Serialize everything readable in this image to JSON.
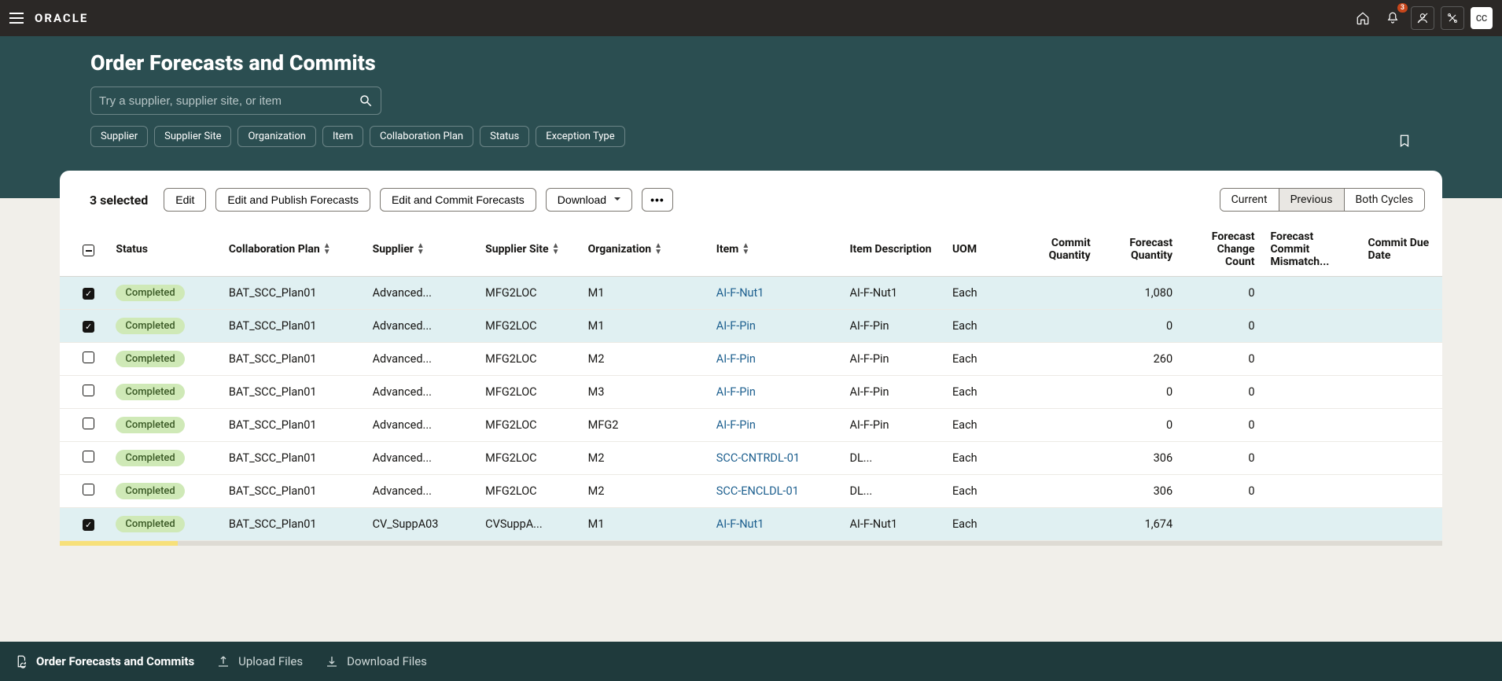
{
  "header": {
    "logo": "ORACLE",
    "notification_count": "3",
    "avatar": "CC"
  },
  "page": {
    "title": "Order Forecasts and Commits",
    "search_placeholder": "Try a supplier, supplier site, or item"
  },
  "filters": [
    "Supplier",
    "Supplier Site",
    "Organization",
    "Item",
    "Collaboration Plan",
    "Status",
    "Exception Type"
  ],
  "toolbar": {
    "selected": "3 selected",
    "edit": "Edit",
    "edit_publish": "Edit and Publish Forecasts",
    "edit_commit": "Edit and Commit Forecasts",
    "download": "Download",
    "seg": {
      "current": "Current",
      "previous": "Previous",
      "both": "Both Cycles"
    }
  },
  "columns": {
    "status": "Status",
    "plan": "Collaboration Plan",
    "supplier": "Supplier",
    "site": "Supplier Site",
    "org": "Organization",
    "item": "Item",
    "desc": "Item Description",
    "uom": "UOM",
    "cq": "Commit Quantity",
    "fq": "Forecast Quantity",
    "fcc": "Forecast Change Count",
    "fcm": "Forecast Commit Mismatch...",
    "cdd": "Commit Due Date"
  },
  "rows": [
    {
      "sel": true,
      "status": "Completed",
      "plan": "BAT_SCC_Plan01",
      "supplier": "Advanced...",
      "site": "MFG2LOC",
      "org": "M1",
      "item": "AI-F-Nut1",
      "desc": "AI-F-Nut1",
      "uom": "Each",
      "cq": "",
      "fq": "1,080",
      "fcc": "0",
      "fcm": "",
      "cdd": ""
    },
    {
      "sel": true,
      "status": "Completed",
      "plan": "BAT_SCC_Plan01",
      "supplier": "Advanced...",
      "site": "MFG2LOC",
      "org": "M1",
      "item": "AI-F-Pin",
      "desc": "AI-F-Pin",
      "uom": "Each",
      "cq": "",
      "fq": "0",
      "fcc": "0",
      "fcm": "",
      "cdd": ""
    },
    {
      "sel": false,
      "status": "Completed",
      "plan": "BAT_SCC_Plan01",
      "supplier": "Advanced...",
      "site": "MFG2LOC",
      "org": "M2",
      "item": "AI-F-Pin",
      "desc": "AI-F-Pin",
      "uom": "Each",
      "cq": "",
      "fq": "260",
      "fcc": "0",
      "fcm": "",
      "cdd": ""
    },
    {
      "sel": false,
      "status": "Completed",
      "plan": "BAT_SCC_Plan01",
      "supplier": "Advanced...",
      "site": "MFG2LOC",
      "org": "M3",
      "item": "AI-F-Pin",
      "desc": "AI-F-Pin",
      "uom": "Each",
      "cq": "",
      "fq": "0",
      "fcc": "0",
      "fcm": "",
      "cdd": ""
    },
    {
      "sel": false,
      "status": "Completed",
      "plan": "BAT_SCC_Plan01",
      "supplier": "Advanced...",
      "site": "MFG2LOC",
      "org": "MFG2",
      "item": "AI-F-Pin",
      "desc": "AI-F-Pin",
      "uom": "Each",
      "cq": "",
      "fq": "0",
      "fcc": "0",
      "fcm": "",
      "cdd": ""
    },
    {
      "sel": false,
      "status": "Completed",
      "plan": "BAT_SCC_Plan01",
      "supplier": "Advanced...",
      "site": "MFG2LOC",
      "org": "M2",
      "item": "SCC-CNTRDL-01",
      "desc": "DL...",
      "uom": "Each",
      "cq": "",
      "fq": "306",
      "fcc": "0",
      "fcm": "",
      "cdd": ""
    },
    {
      "sel": false,
      "status": "Completed",
      "plan": "BAT_SCC_Plan01",
      "supplier": "Advanced...",
      "site": "MFG2LOC",
      "org": "M2",
      "item": "SCC-ENCLDL-01",
      "desc": "DL...",
      "uom": "Each",
      "cq": "",
      "fq": "306",
      "fcc": "0",
      "fcm": "",
      "cdd": ""
    },
    {
      "sel": true,
      "status": "Completed",
      "plan": "BAT_SCC_Plan01",
      "supplier": "CV_SuppA03",
      "site": "CVSuppA...",
      "org": "M1",
      "item": "AI-F-Nut1",
      "desc": "AI-F-Nut1",
      "uom": "Each",
      "cq": "",
      "fq": "1,674",
      "fcc": "",
      "fcm": "",
      "cdd": ""
    }
  ],
  "footer": {
    "tab1": "Order Forecasts and Commits",
    "tab2": "Upload Files",
    "tab3": "Download Files"
  }
}
